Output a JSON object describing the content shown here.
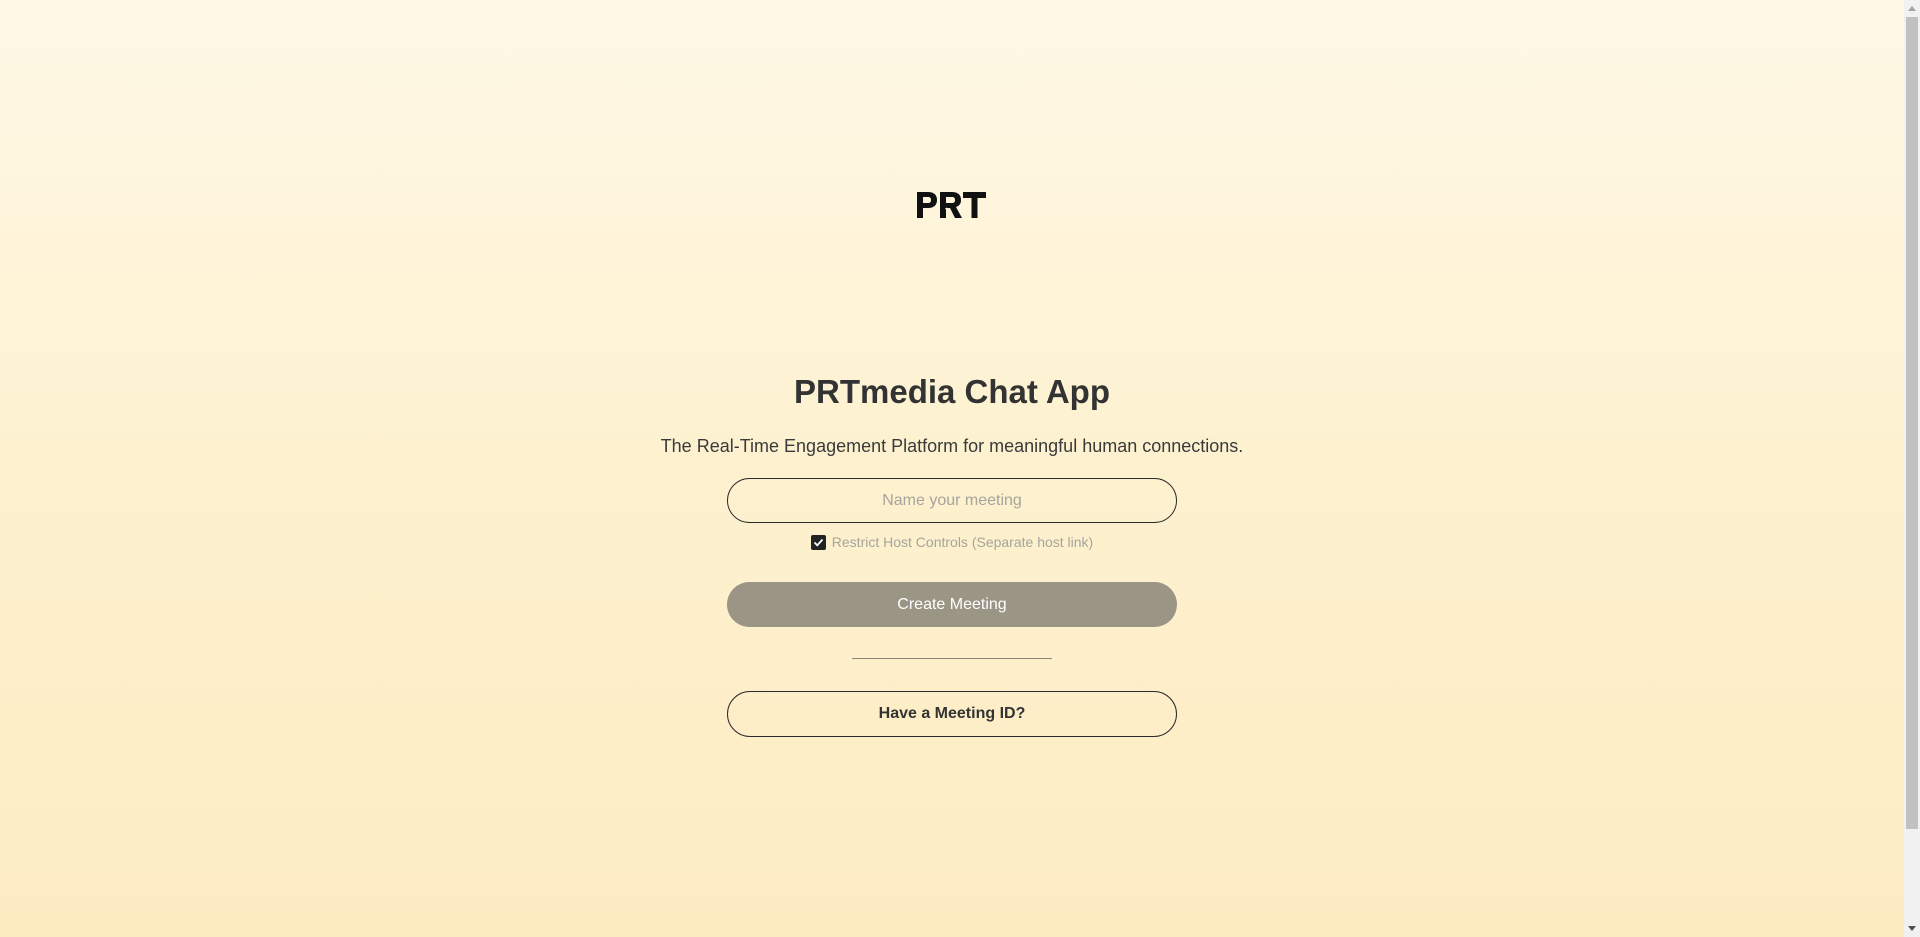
{
  "brand": {
    "logo_text": "PRT"
  },
  "main": {
    "title": "PRTmedia Chat App",
    "subtitle": "The Real-Time Engagement Platform for meaningful human connections."
  },
  "form": {
    "meeting_name_placeholder": "Name your meeting",
    "meeting_name_value": "",
    "restrict_host_label": "Restrict Host Controls (Separate host link)",
    "restrict_host_checked": true,
    "create_button_label": "Create Meeting",
    "meeting_id_button_label": "Have a Meeting ID?"
  },
  "colors": {
    "background_top": "#fef8e6",
    "background_bottom": "#fdecc2",
    "primary_button": "#9b9585",
    "text": "#333333"
  }
}
